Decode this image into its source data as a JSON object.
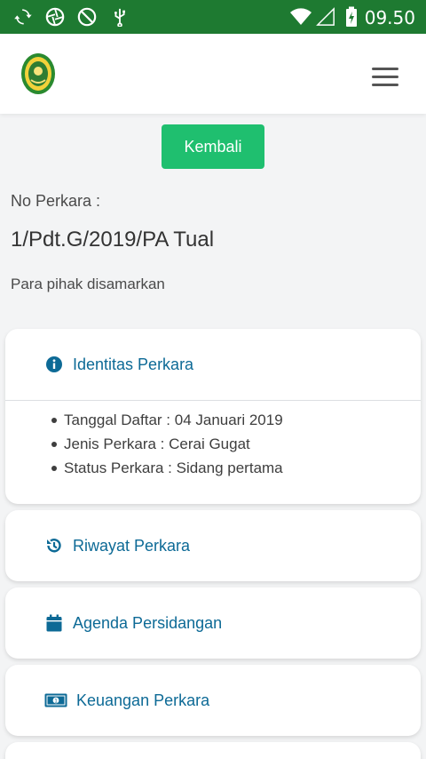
{
  "status_bar": {
    "time": "09.50",
    "icons": [
      "sync-icon",
      "aperture-icon",
      "no-sim-icon",
      "usb-icon",
      "wifi-icon",
      "signal-icon",
      "battery-icon"
    ]
  },
  "header": {
    "logo": "court-emblem-logo",
    "menu_icon": "hamburger-menu-icon"
  },
  "back_button": {
    "label": "Kembali"
  },
  "case": {
    "number_label": "No Perkara :",
    "number_value": "1/Pdt.G/2019/PA Tual",
    "parties_note": "Para pihak disamarkan"
  },
  "sections": [
    {
      "title": "Identitas Perkara",
      "icon": "info-icon",
      "expanded": true,
      "items": [
        "Tanggal Daftar : 04 Januari 2019",
        "Jenis Perkara : Cerai Gugat",
        "Status Perkara : Sidang pertama"
      ]
    },
    {
      "title": "Riwayat Perkara",
      "icon": "history-icon",
      "expanded": false
    },
    {
      "title": "Agenda Persidangan",
      "icon": "calendar-icon",
      "expanded": false
    },
    {
      "title": "Keuangan Perkara",
      "icon": "money-icon",
      "expanded": false
    }
  ],
  "colors": {
    "status_bar": "#1e7a31",
    "primary_button": "#1fbf6f",
    "section_title": "#0d6a96",
    "background": "#f3f4f5"
  }
}
